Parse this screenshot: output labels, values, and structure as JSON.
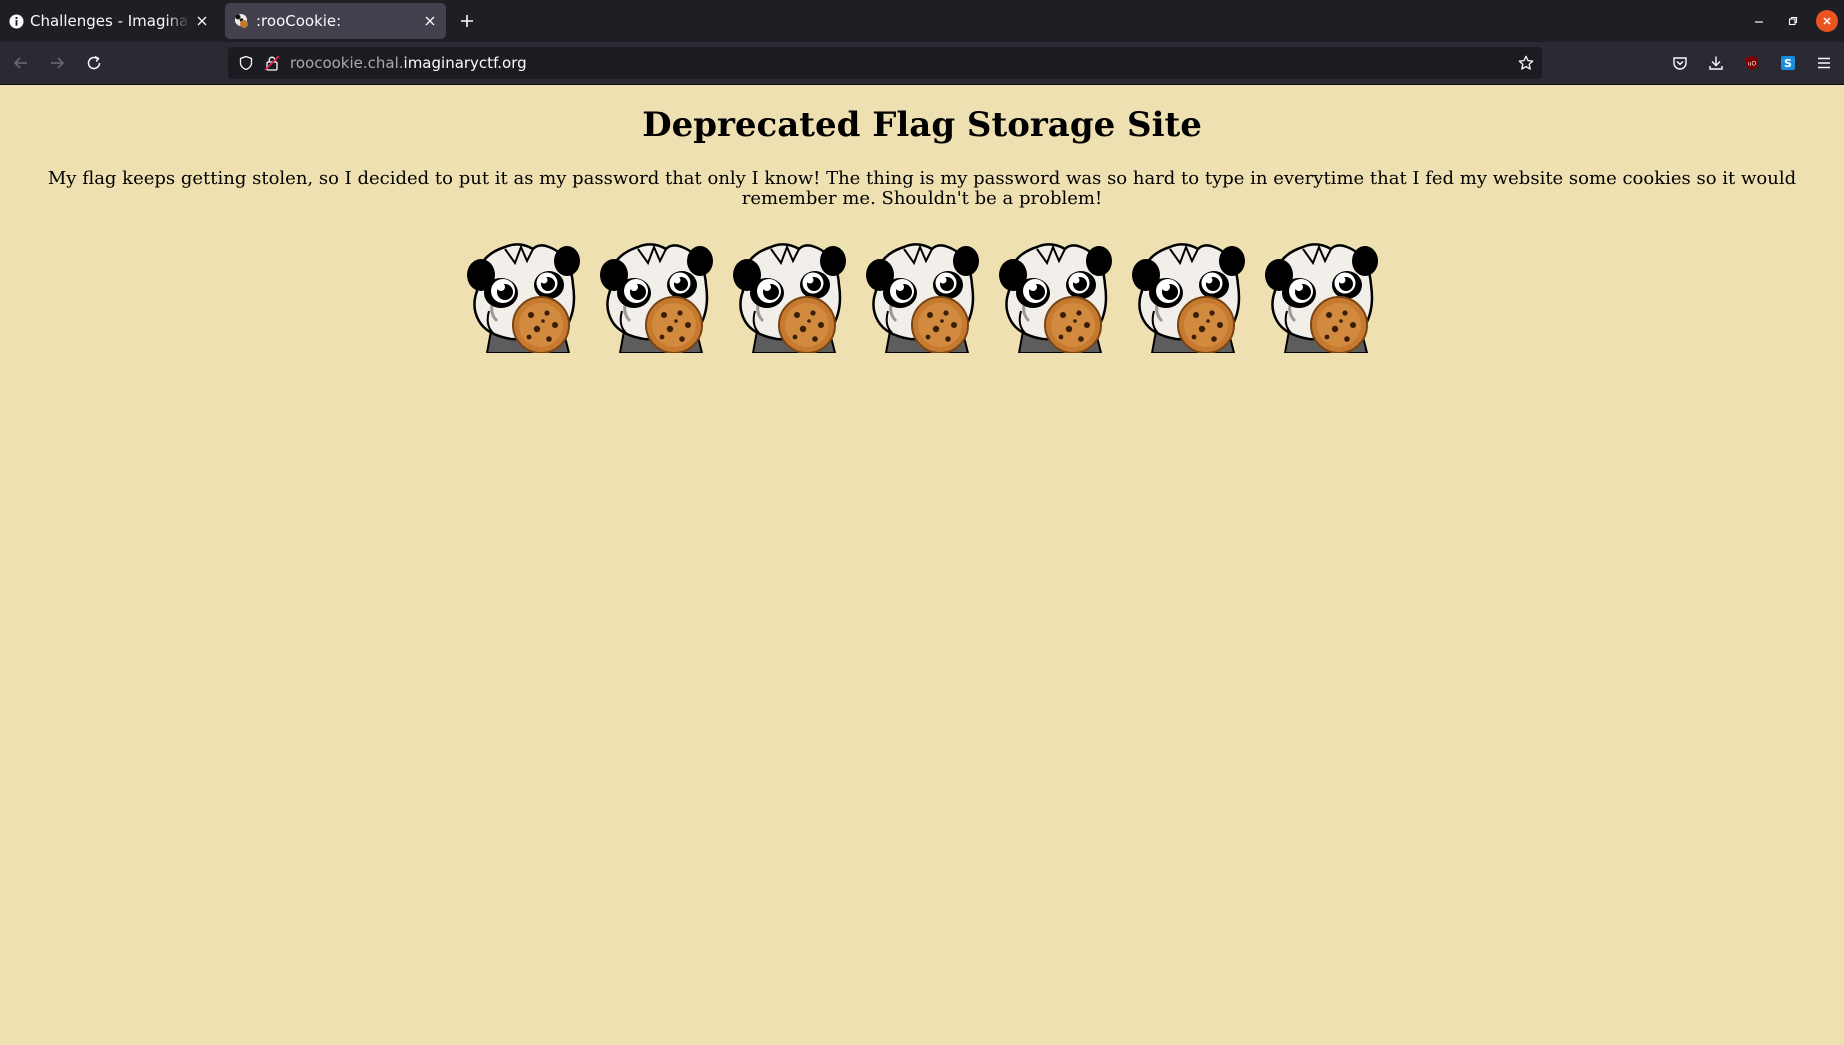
{
  "browser": {
    "tabs": [
      {
        "title": "Challenges - ImaginaryCTF",
        "favicon": "imaginaryctf-info-icon",
        "active": false
      },
      {
        "title": ":rooCookie:",
        "favicon": "roocookie-icon",
        "active": true
      }
    ],
    "url_dim": "roocookie.chal.",
    "url_domain": "imaginaryctf.org"
  },
  "page": {
    "heading": "Deprecated Flag Storage Site",
    "paragraph": "My flag keeps getting stolen, so I decided to put it as my password that only I know! The thing is my password was so hard to type in everytime that I fed my website some cookies so it would remember me. Shouldn't be a problem!",
    "images": [
      {
        "alt": "roocookie"
      },
      {
        "alt": "roocookie"
      },
      {
        "alt": "roocookie"
      },
      {
        "alt": "roocookie"
      },
      {
        "alt": "roocookie"
      },
      {
        "alt": "roocookie"
      },
      {
        "alt": "roocookie"
      }
    ]
  },
  "colors": {
    "page_background": "#eee0b1",
    "tab_strip": "#1f1e23",
    "nav_bar": "#2b2a33",
    "active_tab": "#42414d",
    "window_close": "#e95420"
  }
}
